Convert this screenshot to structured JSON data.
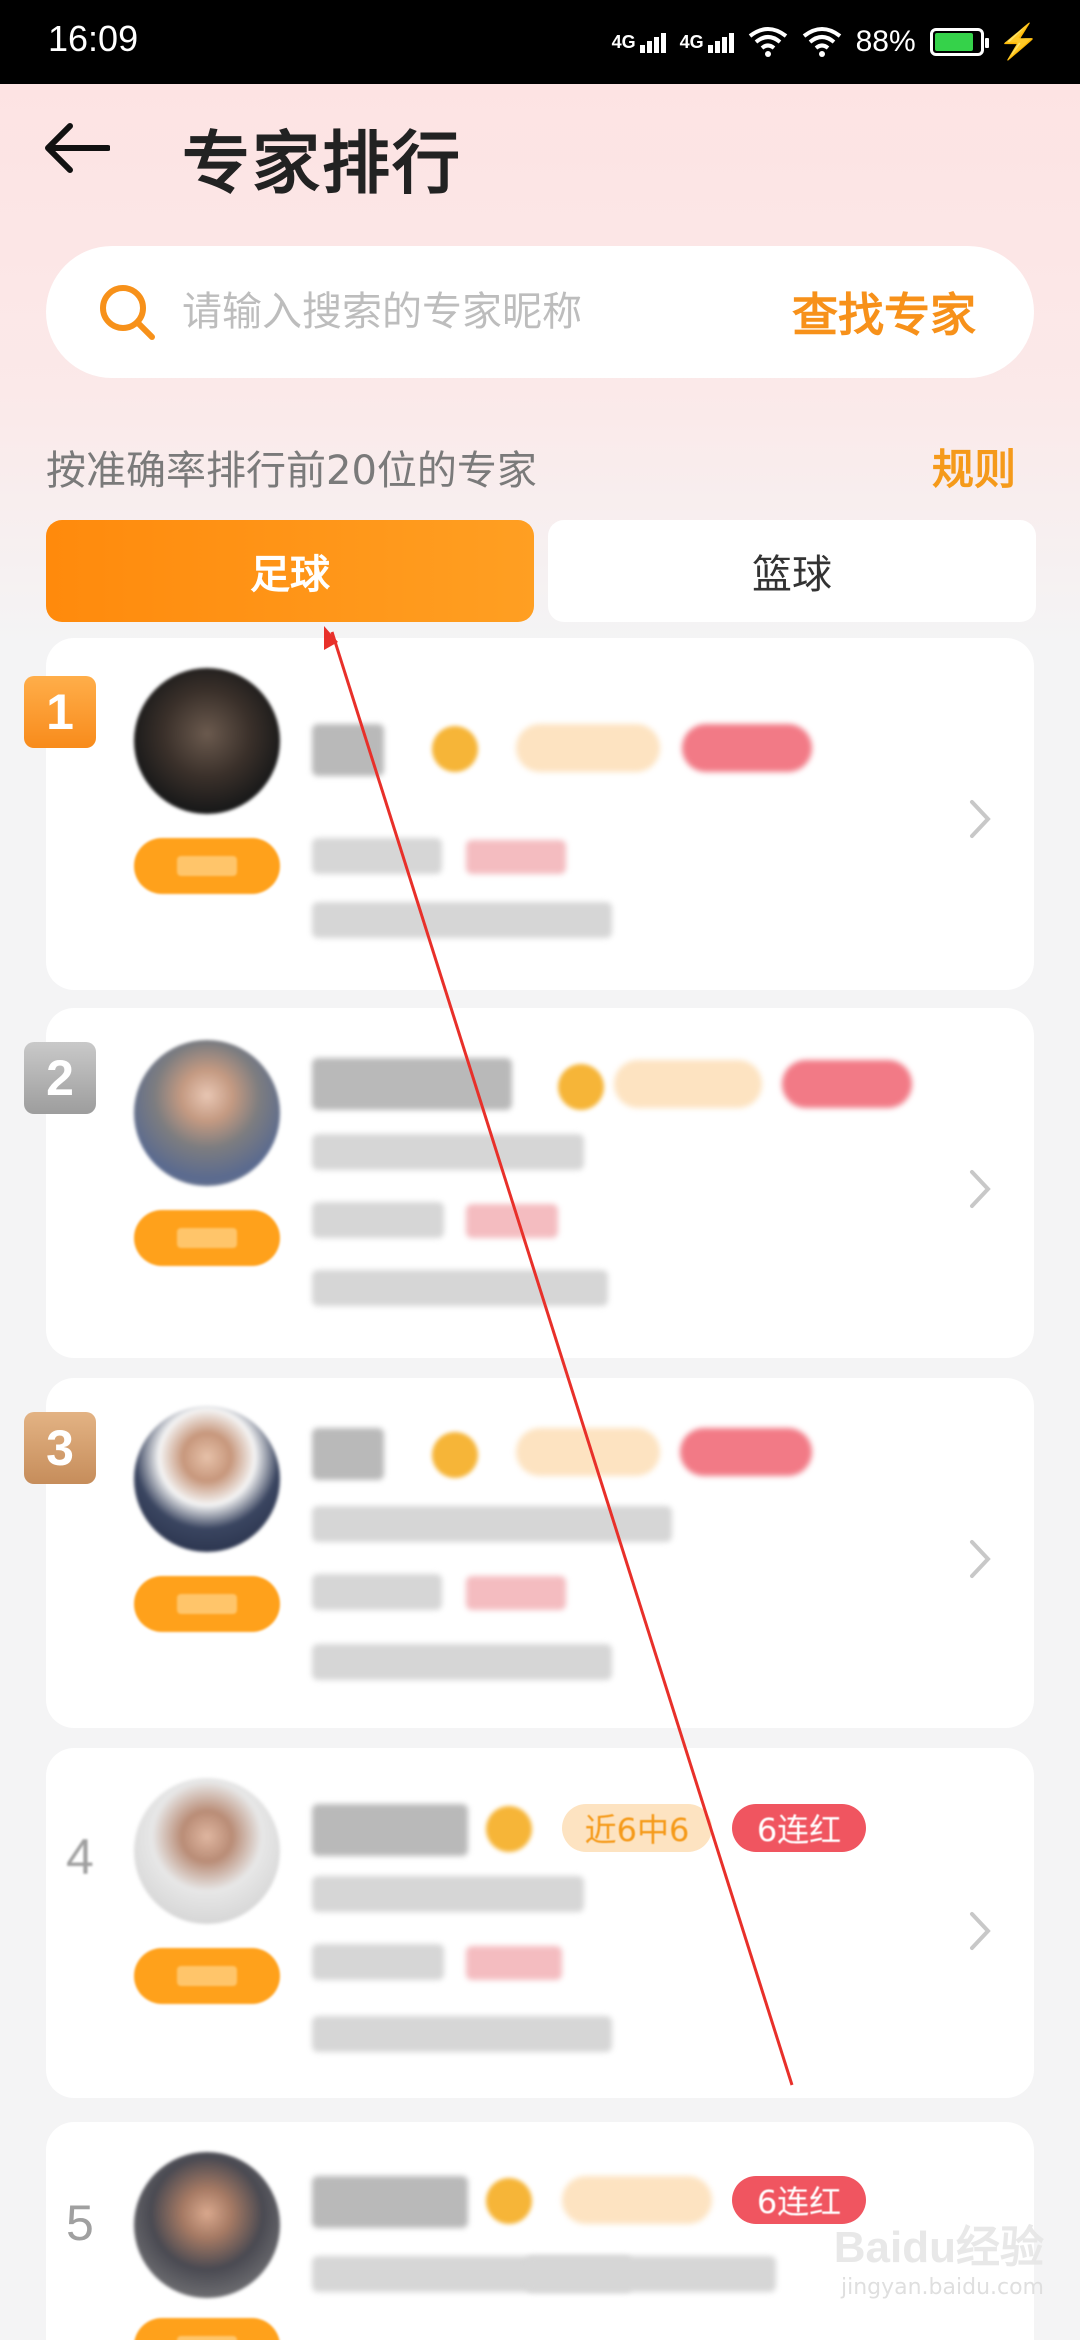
{
  "status_bar": {
    "time": "16:09",
    "network_1": "4G",
    "network_2": "4G",
    "battery": "88%"
  },
  "header": {
    "title": "专家排行"
  },
  "search": {
    "placeholder": "请输入搜索的专家昵称",
    "button_label": "查找专家"
  },
  "section": {
    "subtitle": "按准确率排行前20位的专家",
    "rules_label": "规则"
  },
  "tabs": [
    {
      "label": "足球",
      "active": true
    },
    {
      "label": "篮球",
      "active": false
    }
  ],
  "experts": [
    {
      "rank": "1",
      "tag_streak": "",
      "tag_hot": ""
    },
    {
      "rank": "2",
      "tag_streak": "",
      "tag_hot": ""
    },
    {
      "rank": "3",
      "tag_streak": "",
      "tag_hot": ""
    },
    {
      "rank": "4",
      "tag_streak": "近6中6",
      "tag_hot": "6连红"
    },
    {
      "rank": "5",
      "tag_streak": "",
      "tag_hot": "6连红"
    }
  ],
  "watermark": {
    "main": "Baidu经验",
    "sub": "jingyan.baidu.com"
  },
  "colors": {
    "accent": "#ff8a0c",
    "accent_text": "#f7911a",
    "annotation_arrow": "#e8302a"
  }
}
